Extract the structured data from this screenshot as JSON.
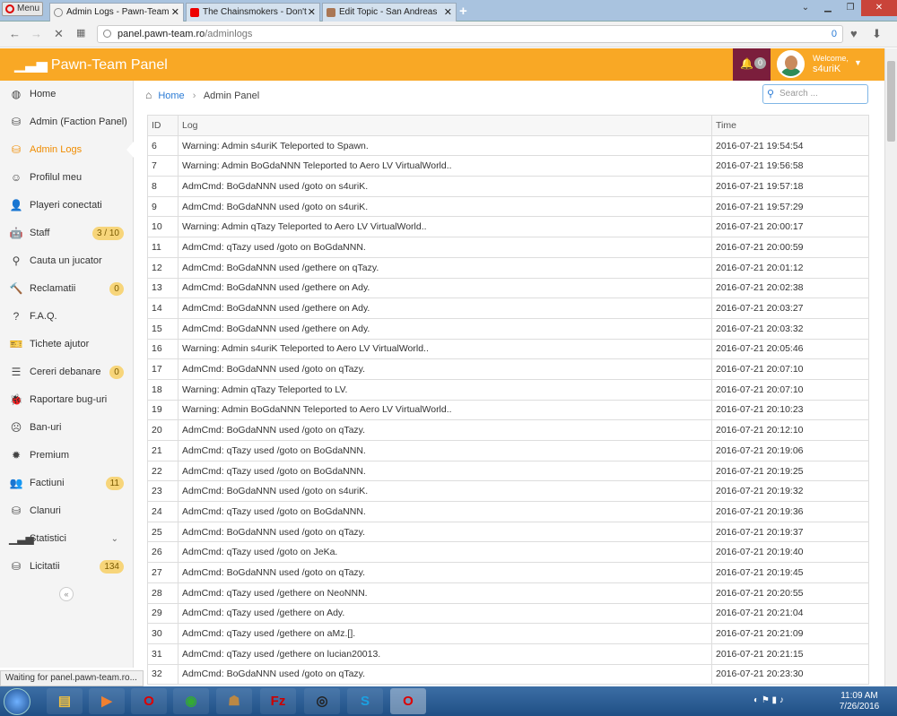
{
  "browser": {
    "menu_label": "Menu",
    "tabs": [
      {
        "title": "Admin Logs - Pawn-Team",
        "active": true
      },
      {
        "title": "The Chainsmokers - Don't",
        "active": false
      },
      {
        "title": "Edit Topic - San Andreas",
        "active": false
      }
    ],
    "new_tab": "+",
    "url_host": "panel.pawn-team.ro",
    "url_path": "/adminlogs",
    "ad_count": "0"
  },
  "header": {
    "brand": "Pawn-Team Panel",
    "notifications": "0",
    "welcome": "Welcome,",
    "username": "s4uriK"
  },
  "sidebar": {
    "items": [
      {
        "label": "Home",
        "icon": "dashboard-icon",
        "glyph": "◍"
      },
      {
        "label": "Admin (Faction Panel)",
        "icon": "sitemap-icon",
        "glyph": "⛁"
      },
      {
        "label": "Admin Logs",
        "icon": "sitemap-icon",
        "glyph": "⛁",
        "active": true
      },
      {
        "label": "Profilul meu",
        "icon": "smile-icon",
        "glyph": "☺"
      },
      {
        "label": "Playeri conectati",
        "icon": "user-icon",
        "glyph": "👤"
      },
      {
        "label": "Staff",
        "icon": "android-icon",
        "glyph": "🤖",
        "badge": "3 / 10"
      },
      {
        "label": "Cauta un jucator",
        "icon": "search-icon",
        "glyph": "⚲"
      },
      {
        "label": "Reclamatii",
        "icon": "gavel-icon",
        "glyph": "🔨",
        "badge": "0"
      },
      {
        "label": "F.A.Q.",
        "icon": "question-icon",
        "glyph": "?"
      },
      {
        "label": "Tichete ajutor",
        "icon": "ticket-icon",
        "glyph": "🎫"
      },
      {
        "label": "Cereri debanare",
        "icon": "list-icon",
        "glyph": "☰",
        "badge": "0"
      },
      {
        "label": "Raportare bug-uri",
        "icon": "bug-icon",
        "glyph": "🐞"
      },
      {
        "label": "Ban-uri",
        "icon": "frown-icon",
        "glyph": "☹"
      },
      {
        "label": "Premium",
        "icon": "cog-icon",
        "glyph": "✹"
      },
      {
        "label": "Factiuni",
        "icon": "users-icon",
        "glyph": "👥",
        "badge": "11"
      },
      {
        "label": "Clanuri",
        "icon": "sitemap-icon",
        "glyph": "⛁"
      },
      {
        "label": "Statistici",
        "icon": "signal-icon",
        "glyph": "▁▃▅",
        "chevron": "⌄"
      },
      {
        "label": "Licitatii",
        "icon": "sitemap-icon",
        "glyph": "⛁",
        "badge": "134"
      }
    ],
    "collapse": "«"
  },
  "main": {
    "breadcrumb": {
      "home": "Home",
      "current": "Admin Panel"
    },
    "search_placeholder": "Search ...",
    "columns": [
      "ID",
      "Log",
      "Time"
    ],
    "rows": [
      [
        "6",
        "Warning: Admin s4uriK Teleported to Spawn.",
        "2016-07-21 19:54:54"
      ],
      [
        "7",
        "Warning: Admin BoGdaNNN Teleported to Aero LV VirtualWorld..",
        "2016-07-21 19:56:58"
      ],
      [
        "8",
        "AdmCmd: BoGdaNNN used /goto on s4uriK.",
        "2016-07-21 19:57:18"
      ],
      [
        "9",
        "AdmCmd: BoGdaNNN used /goto on s4uriK.",
        "2016-07-21 19:57:29"
      ],
      [
        "10",
        "Warning: Admin qTazy Teleported to Aero LV VirtualWorld..",
        "2016-07-21 20:00:17"
      ],
      [
        "11",
        "AdmCmd: qTazy used /goto on BoGdaNNN.",
        "2016-07-21 20:00:59"
      ],
      [
        "12",
        "AdmCmd: BoGdaNNN used /gethere on qTazy.",
        "2016-07-21 20:01:12"
      ],
      [
        "13",
        "AdmCmd: BoGdaNNN used /gethere on Ady.",
        "2016-07-21 20:02:38"
      ],
      [
        "14",
        "AdmCmd: BoGdaNNN used /gethere on Ady.",
        "2016-07-21 20:03:27"
      ],
      [
        "15",
        "AdmCmd: BoGdaNNN used /gethere on Ady.",
        "2016-07-21 20:03:32"
      ],
      [
        "16",
        "Warning: Admin s4uriK Teleported to Aero LV VirtualWorld..",
        "2016-07-21 20:05:46"
      ],
      [
        "17",
        "AdmCmd: BoGdaNNN used /goto on qTazy.",
        "2016-07-21 20:07:10"
      ],
      [
        "18",
        "Warning: Admin qTazy Teleported to LV.",
        "2016-07-21 20:07:10"
      ],
      [
        "19",
        "Warning: Admin BoGdaNNN Teleported to Aero LV VirtualWorld..",
        "2016-07-21 20:10:23"
      ],
      [
        "20",
        "AdmCmd: BoGdaNNN used /goto on qTazy.",
        "2016-07-21 20:12:10"
      ],
      [
        "21",
        "AdmCmd: qTazy used /goto on BoGdaNNN.",
        "2016-07-21 20:19:06"
      ],
      [
        "22",
        "AdmCmd: qTazy used /goto on BoGdaNNN.",
        "2016-07-21 20:19:25"
      ],
      [
        "23",
        "AdmCmd: BoGdaNNN used /goto on s4uriK.",
        "2016-07-21 20:19:32"
      ],
      [
        "24",
        "AdmCmd: qTazy used /goto on BoGdaNNN.",
        "2016-07-21 20:19:36"
      ],
      [
        "25",
        "AdmCmd: BoGdaNNN used /goto on qTazy.",
        "2016-07-21 20:19:37"
      ],
      [
        "26",
        "AdmCmd: qTazy used /goto on JeKa.",
        "2016-07-21 20:19:40"
      ],
      [
        "27",
        "AdmCmd: BoGdaNNN used /goto on qTazy.",
        "2016-07-21 20:19:45"
      ],
      [
        "28",
        "AdmCmd: qTazy used /gethere on NeoNNN.",
        "2016-07-21 20:20:55"
      ],
      [
        "29",
        "AdmCmd: qTazy used /gethere on Ady.",
        "2016-07-21 20:21:04"
      ],
      [
        "30",
        "AdmCmd: qTazy used /gethere on aMz.[].",
        "2016-07-21 20:21:09"
      ],
      [
        "31",
        "AdmCmd: qTazy used /gethere on lucian20013.",
        "2016-07-21 20:21:15"
      ],
      [
        "32",
        "AdmCmd: BoGdaNNN used /goto on qTazy.",
        "2016-07-21 20:23:30"
      ]
    ]
  },
  "status_text": "Waiting for panel.pawn-team.ro...",
  "taskbar": {
    "apps": [
      {
        "name": "explorer-taskbar-button",
        "glyph": "▤",
        "color": "#f0c040"
      },
      {
        "name": "media-player-taskbar-button",
        "glyph": "▶",
        "color": "#f08030"
      },
      {
        "name": "opera-taskbar-button",
        "glyph": "O",
        "color": "#d00"
      },
      {
        "name": "chrome-taskbar-button",
        "glyph": "◉",
        "color": "#3a3"
      },
      {
        "name": "game-taskbar-button",
        "glyph": "☗",
        "color": "#b84"
      },
      {
        "name": "filezilla-taskbar-button",
        "glyph": "Fz",
        "color": "#c00"
      },
      {
        "name": "obs-taskbar-button",
        "glyph": "◎",
        "color": "#222"
      },
      {
        "name": "skype-taskbar-button",
        "glyph": "S",
        "color": "#1ba1e2"
      },
      {
        "name": "opera-active-taskbar-button",
        "glyph": "O",
        "color": "#d00"
      }
    ],
    "time": "11:09 AM",
    "date": "7/26/2016"
  },
  "colors": {
    "header": "#f9a825",
    "accent": "#f08c00",
    "notif": "#7b1e3c",
    "link": "#2a7bd5"
  }
}
